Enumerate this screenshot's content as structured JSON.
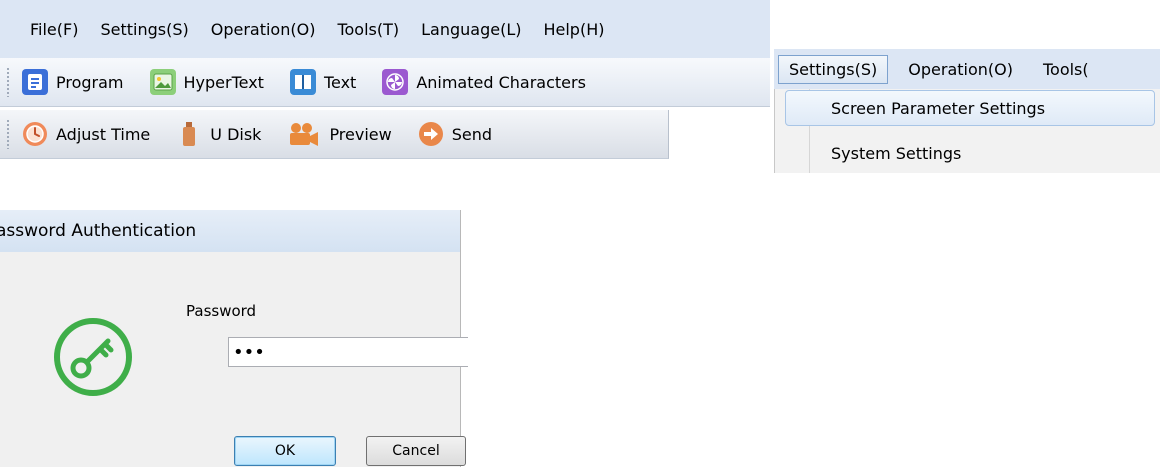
{
  "menubar": {
    "items": [
      "File(F)",
      "Settings(S)",
      "Operation(O)",
      "Tools(T)",
      "Language(L)",
      "Help(H)"
    ]
  },
  "toolbar1": {
    "items": [
      {
        "label": "Program",
        "icon": "program-icon"
      },
      {
        "label": "HyperText",
        "icon": "image-icon"
      },
      {
        "label": "Text",
        "icon": "book-icon"
      },
      {
        "label": "Animated Characters",
        "icon": "pinwheel-icon"
      }
    ]
  },
  "toolbar2": {
    "items": [
      {
        "label": "Adjust Time",
        "icon": "clock-icon"
      },
      {
        "label": "U Disk",
        "icon": "usb-disk-icon"
      },
      {
        "label": "Preview",
        "icon": "camera-icon"
      },
      {
        "label": "Send",
        "icon": "send-arrow-icon"
      }
    ]
  },
  "settings_menu": {
    "menubar_items": [
      "Settings(S)",
      "Operation(O)",
      "Tools("
    ],
    "items": [
      "Screen Parameter Settings",
      "System Settings"
    ]
  },
  "dialog": {
    "title": "Password Authentication",
    "title_visible": "assword Authentication",
    "password_label": "Password",
    "password_value": "•••",
    "ok_label": "OK",
    "cancel_label": "Cancel"
  },
  "colors": {
    "menubar_bg": "#dce6f4",
    "key_icon": "#3fae49",
    "accent": "#3c7fb1"
  }
}
